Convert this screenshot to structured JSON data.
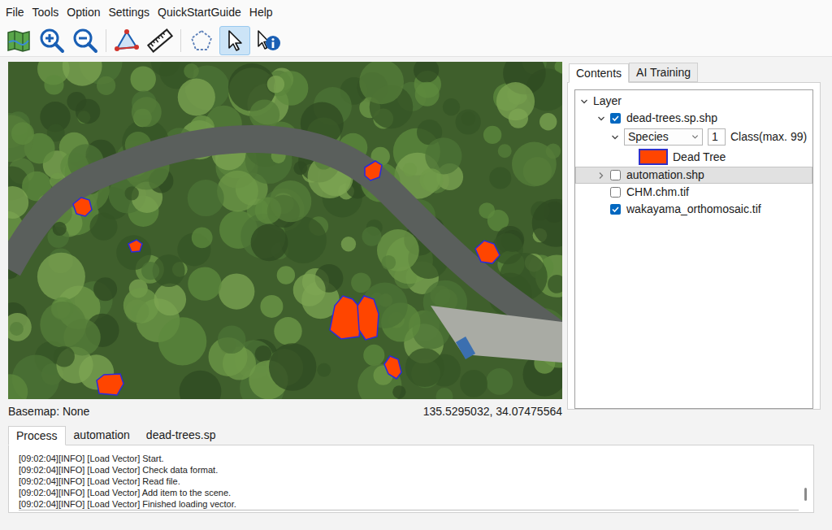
{
  "menu": [
    "File",
    "Tools",
    "Option",
    "Settings",
    "QuickStartGuide",
    "Help"
  ],
  "toolbar": [
    {
      "kind": "map",
      "selected": false
    },
    {
      "kind": "zoom-in",
      "selected": false
    },
    {
      "kind": "zoom-out",
      "selected": false
    },
    {
      "kind": "measure-area",
      "selected": false
    },
    {
      "kind": "ruler",
      "selected": false
    },
    {
      "kind": "polygon",
      "selected": false
    },
    {
      "kind": "pointer",
      "selected": true
    },
    {
      "kind": "info",
      "selected": false
    }
  ],
  "map": {
    "basemap": "Basemap: None",
    "coordinates": "135.5295032, 34.07475564"
  },
  "panel_tabs": [
    {
      "label": "Contents",
      "selected": true
    },
    {
      "label": "AI Training",
      "selected": false
    }
  ],
  "tree": {
    "root": {
      "label": "Layer",
      "expanded": true
    },
    "layers": [
      {
        "label": "dead-trees.sp.shp",
        "checked": true,
        "expanded": true,
        "selected": false,
        "style": {
          "expanded": true,
          "field": "Species",
          "class_count": "1",
          "class_note": "Class(max. 99)",
          "classes": [
            {
              "label": "Dead Tree",
              "color": "#ff4500"
            }
          ]
        }
      },
      {
        "label": "automation.shp",
        "checked": false,
        "expanded": false,
        "selected": true
      },
      {
        "label": "CHM.chm.tif",
        "checked": false,
        "selected": false
      },
      {
        "label": "wakayama_orthomosaic.tif",
        "checked": true,
        "selected": false
      }
    ]
  },
  "bottom_tabs": [
    {
      "label": "Process",
      "selected": true
    },
    {
      "label": "automation",
      "selected": false
    },
    {
      "label": "dead-trees.sp",
      "selected": false
    }
  ],
  "log": [
    "[09:02:04][INFO] [Load Vector] Start.",
    "[09:02:04][INFO] [Load Vector] Check data format.",
    "[09:02:04][INFO] [Load Vector] Read file.",
    "[09:02:04][INFO] [Load Vector] Add item to the scene.",
    "[09:02:04][INFO] [Load Vector] Finished loading vector."
  ]
}
